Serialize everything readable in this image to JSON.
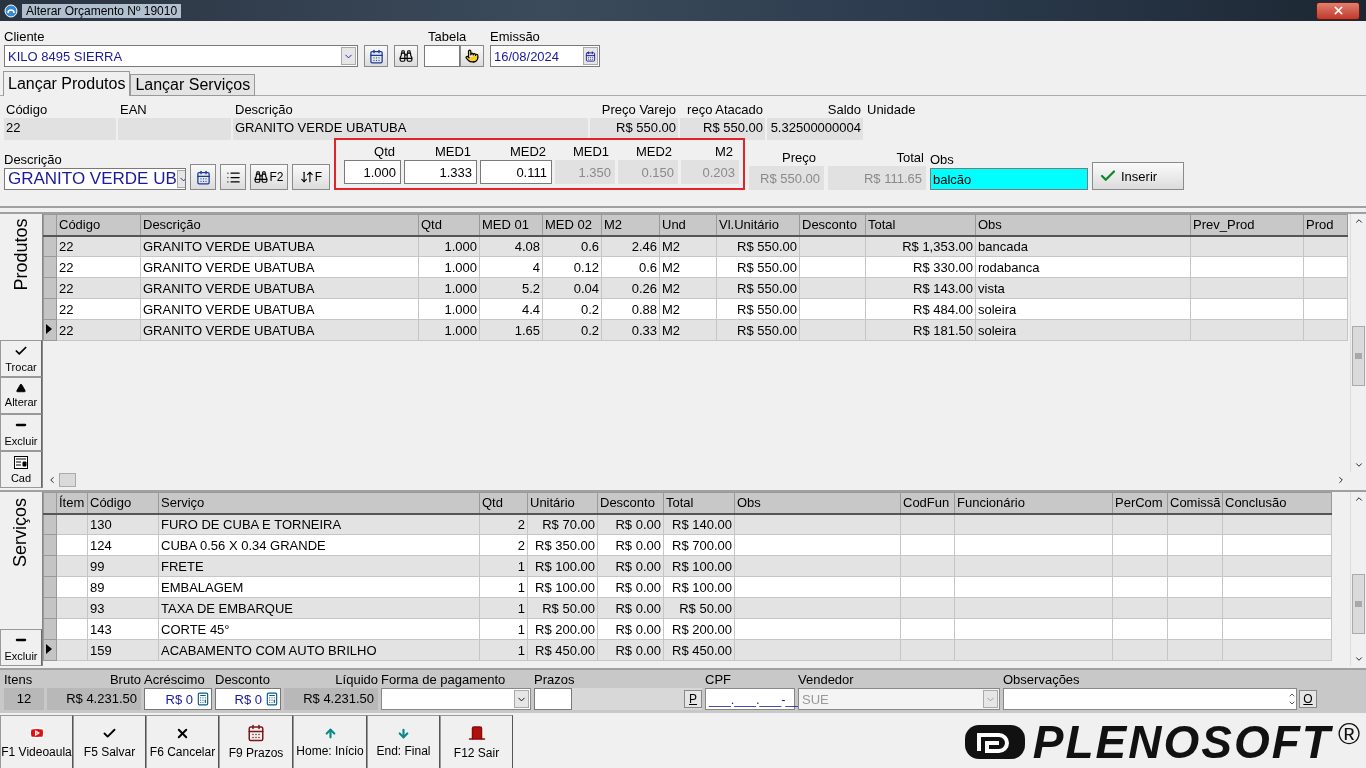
{
  "window": {
    "title": "Alterar Orçamento Nº 19010"
  },
  "header": {
    "cliente_label": "Cliente",
    "cliente": "KILO 8495 SIERRA",
    "tabela_label": "Tabela",
    "emissao_label": "Emissão",
    "emissao": "16/08/2024"
  },
  "tabs": [
    {
      "label": "Lançar Produtos",
      "selected": true
    },
    {
      "label": "Lançar Serviços",
      "selected": false
    }
  ],
  "product_info": [
    {
      "label": "Código",
      "value": "22"
    },
    {
      "label": "EAN"
    },
    {
      "label": "Descrição",
      "value": "GRANITO VERDE UBATUBA"
    },
    {
      "label": "Preço Varejo",
      "value": "R$ 550.00"
    },
    {
      "label": "reço Atacado",
      "value": "R$ 550.00"
    },
    {
      "label": "Saldo",
      "value": "5.32500000004"
    },
    {
      "label": "Unidade"
    }
  ],
  "entry": {
    "descricao_label": "Descrição",
    "descricao": "GRANITO VERDE UB",
    "shortcut_buttons": [
      "F2",
      "F"
    ],
    "measures": [
      {
        "label": "Qtd",
        "value": "1.000",
        "kind": "input"
      },
      {
        "label": "MED1",
        "value": "1.333",
        "kind": "input"
      },
      {
        "label": "MED2",
        "value": "0.111",
        "kind": "input"
      },
      {
        "label": "MED1",
        "value": "1.350",
        "kind": "readonly"
      },
      {
        "label": "MED2",
        "value": "0.150",
        "kind": "readonly"
      },
      {
        "label": "M2",
        "value": "0.203",
        "kind": "readonly"
      }
    ],
    "preco_label": "Preço",
    "preco": "R$ 550.00",
    "total_label": "Total",
    "total": "R$ 111.65",
    "obs_label": "Obs",
    "obs": "balcão",
    "obs_focused": true,
    "insert_button": "Inserir"
  },
  "products": {
    "side_label": "Produtos",
    "actions": [
      "Trocar",
      "Alterar",
      "Excluir",
      "Cad"
    ],
    "columns": [
      "Código",
      "Descrição",
      "Qtd",
      "MED 01",
      "MED 02",
      "M2",
      "Und",
      "Vl.Unitário",
      "Desconto",
      "Total",
      "Obs",
      "Prev_Prod",
      "Prod"
    ],
    "rows": [
      {
        "codigo": "22",
        "descricao": "GRANITO VERDE UBATUBA",
        "qtd": "1.000",
        "med01": "4.08",
        "med02": "0.6",
        "m2": "2.46",
        "und": "M2",
        "unitario": "R$ 550.00",
        "total": "R$ 1,353.00",
        "obs": "bancada",
        "selected": false
      },
      {
        "codigo": "22",
        "descricao": "GRANITO VERDE UBATUBA",
        "qtd": "1.000",
        "med01": "4",
        "med02": "0.12",
        "m2": "0.6",
        "und": "M2",
        "unitario": "R$ 550.00",
        "total": "R$ 330.00",
        "obs": "rodabanca",
        "selected": false
      },
      {
        "codigo": "22",
        "descricao": "GRANITO VERDE UBATUBA",
        "qtd": "1.000",
        "med01": "5.2",
        "med02": "0.04",
        "m2": "0.26",
        "und": "M2",
        "unitario": "R$ 550.00",
        "total": "R$ 143.00",
        "obs": "vista",
        "selected": false
      },
      {
        "codigo": "22",
        "descricao": "GRANITO VERDE UBATUBA",
        "qtd": "1.000",
        "med01": "4.4",
        "med02": "0.2",
        "m2": "0.88",
        "und": "M2",
        "unitario": "R$ 550.00",
        "total": "R$ 484.00",
        "obs": "soleira",
        "selected": false
      },
      {
        "codigo": "22",
        "descricao": "GRANITO VERDE UBATUBA",
        "qtd": "1.000",
        "med01": "1.65",
        "med02": "0.2",
        "m2": "0.33",
        "und": "M2",
        "unitario": "R$ 550.00",
        "total": "R$ 181.50",
        "obs": "soleira",
        "selected": true
      }
    ]
  },
  "services": {
    "side_label": "Serviços",
    "actions": [
      "Excluir"
    ],
    "columns": [
      "Ítem",
      "Código",
      "Serviço",
      "Qtd",
      "Unitário",
      "Desconto",
      "Total",
      "Obs",
      "CodFun",
      "Funcionário",
      "PerCom",
      "Comissã",
      "Conclusão"
    ],
    "rows": [
      {
        "codigo": "130",
        "servico": "FURO DE CUBA E TORNEIRA",
        "qtd": "2",
        "unitario": "R$ 70.00",
        "desconto": "R$ 0.00",
        "total": "R$ 140.00",
        "selected": false
      },
      {
        "codigo": "124",
        "servico": "CUBA 0.56 X 0.34 GRANDE",
        "qtd": "2",
        "unitario": "R$ 350.00",
        "desconto": "R$ 0.00",
        "total": "R$ 700.00",
        "selected": false
      },
      {
        "codigo": "99",
        "servico": "FRETE",
        "qtd": "1",
        "unitario": "R$ 100.00",
        "desconto": "R$ 0.00",
        "total": "R$ 100.00",
        "selected": false
      },
      {
        "codigo": "89",
        "servico": "EMBALAGEM",
        "qtd": "1",
        "unitario": "R$ 100.00",
        "desconto": "R$ 0.00",
        "total": "R$ 100.00",
        "selected": false
      },
      {
        "codigo": "93",
        "servico": "TAXA DE EMBARQUE",
        "qtd": "1",
        "unitario": "R$ 50.00",
        "desconto": "R$ 0.00",
        "total": "R$ 50.00",
        "selected": false
      },
      {
        "codigo": "143",
        "servico": "CORTE 45°",
        "qtd": "1",
        "unitario": "R$ 200.00",
        "desconto": "R$ 0.00",
        "total": "R$ 200.00",
        "selected": false
      },
      {
        "codigo": "159",
        "servico": "ACABAMENTO COM AUTO BRILHO",
        "qtd": "1",
        "unitario": "R$ 450.00",
        "desconto": "R$ 0.00",
        "total": "R$ 450.00",
        "selected": true
      }
    ]
  },
  "totals": {
    "itens": {
      "label": "Itens",
      "value": "12"
    },
    "bruto": {
      "label": "Bruto",
      "value": "R$ 4.231.50"
    },
    "acrescimo": {
      "label": "Acréscimo",
      "value": "R$ 0"
    },
    "desconto": {
      "label": "Desconto",
      "value": "R$ 0"
    },
    "liquido": {
      "label": "Líquido",
      "value": "R$ 4.231.50"
    },
    "forma_pagamento": {
      "label": "Forma de pagamento"
    },
    "prazos": {
      "label": "Prazos",
      "button": "P"
    },
    "cpf": {
      "label": "CPF",
      "value": "___.___.___-__"
    },
    "vendedor": {
      "label": "Vendedor",
      "value": "SUE",
      "disabled": true
    },
    "observacoes": {
      "label": "Observações",
      "button": "O"
    }
  },
  "buttons": [
    "F1 Videoaula",
    "F5 Salvar",
    "F6 Cancelar",
    "F9 Prazos",
    "Home: Início",
    "End: Final",
    "F12 Sair"
  ],
  "logo": {
    "text": "PLENOSOFT",
    "mark": "®"
  }
}
